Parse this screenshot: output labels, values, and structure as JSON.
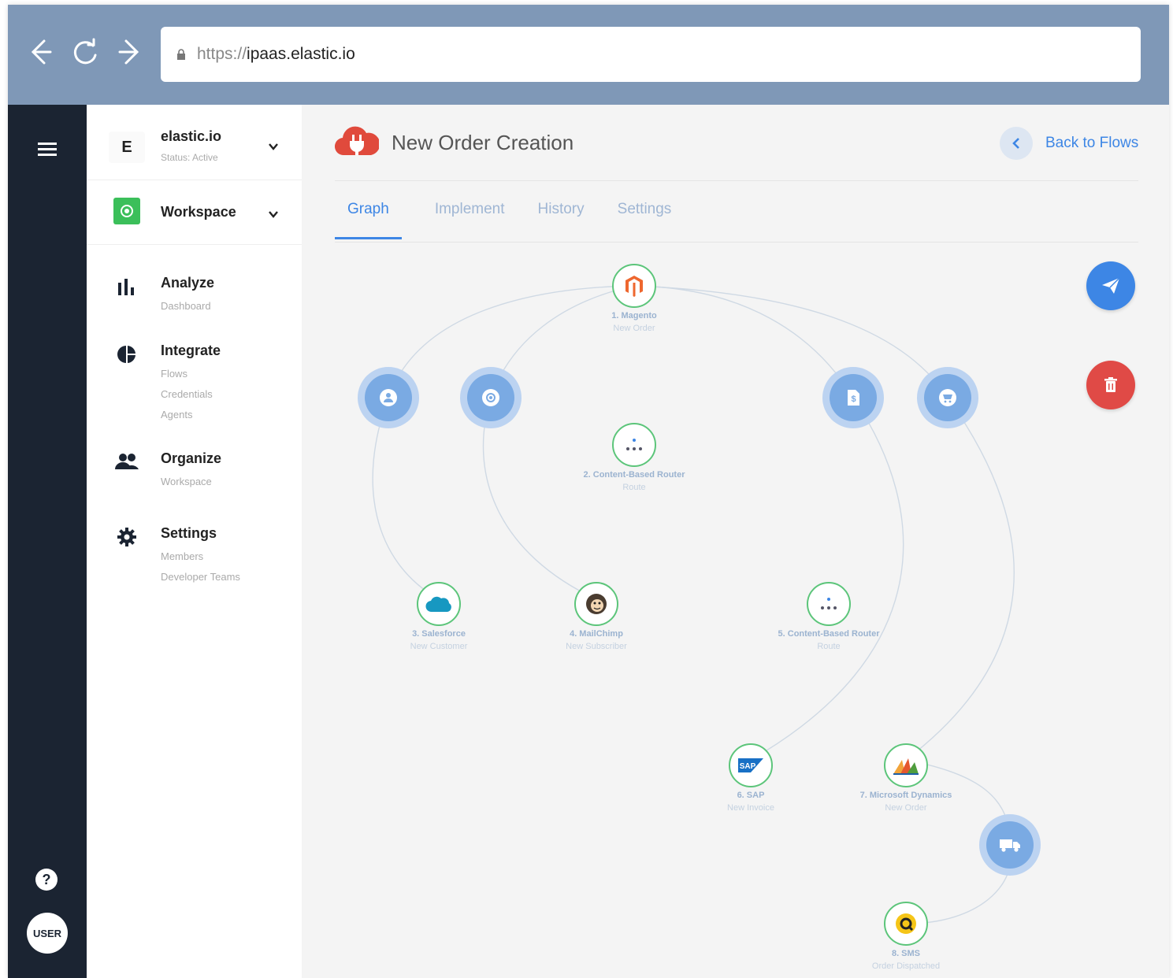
{
  "browser": {
    "url_scheme": "https://",
    "url_host": "ipaas.elastic.io"
  },
  "org": {
    "letter": "E",
    "name": "elastic.io",
    "status": "Status: Active"
  },
  "workspace": {
    "name": "Workspace"
  },
  "nav": {
    "analyze": {
      "title": "Analyze",
      "items": [
        "Dashboard"
      ]
    },
    "integrate": {
      "title": "Integrate",
      "items": [
        "Flows",
        "Credentials",
        "Agents"
      ]
    },
    "organize": {
      "title": "Organize",
      "items": [
        "Workspace"
      ]
    },
    "settings": {
      "title": "Settings",
      "items": [
        "Members",
        "Developer Teams"
      ]
    }
  },
  "rail": {
    "help": "?",
    "user": "USER"
  },
  "header": {
    "title": "New Order Creation",
    "back_label": "Back to Flows"
  },
  "tabs": [
    "Graph",
    "Implement",
    "History",
    "Settings"
  ],
  "nodes": {
    "n1": {
      "title": "1. Magento",
      "sub": "New Order"
    },
    "n2": {
      "title": "2. Content-Based Router",
      "sub": "Route"
    },
    "n3": {
      "title": "3. Salesforce",
      "sub": "New Customer"
    },
    "n4": {
      "title": "4. MailChimp",
      "sub": "New Subscriber"
    },
    "n5": {
      "title": "5. Content-Based Router",
      "sub": "Route"
    },
    "n6": {
      "title": "6. SAP",
      "sub": "New Invoice"
    },
    "n7": {
      "title": "7. Microsoft Dynamics",
      "sub": "New Order"
    },
    "n8": {
      "title": "8. SMS",
      "sub": "Order Dispatched"
    }
  },
  "colors": {
    "accent": "#3d86e5",
    "danger": "#e04a46",
    "rail": "#1b2432",
    "chrome": "#7f98b7",
    "node_border": "#5cc57a"
  }
}
